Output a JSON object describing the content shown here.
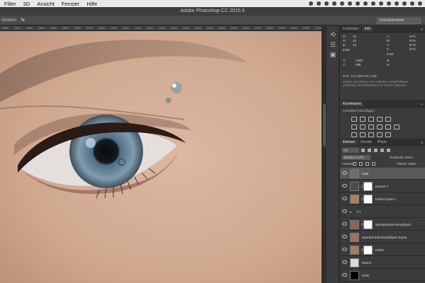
{
  "menubar": {
    "items": [
      "Filter",
      "3D",
      "Ansicht",
      "Fenster",
      "Hilfe"
    ]
  },
  "window": {
    "title": "Adobe Photoshop CC 2015.5"
  },
  "options_bar": {
    "left_label": "chützen",
    "workspace": "Grundelemente"
  },
  "ruler": {
    "ticks": [
      "1200",
      "1220",
      "1240",
      "1260",
      "1280",
      "1300",
      "1320",
      "1340",
      "1360",
      "1380",
      "1400",
      "1420",
      "1440",
      "1460",
      "1480",
      "1500",
      "1520",
      "1540",
      "1560",
      "1580",
      "1600",
      "1620",
      "1640",
      "1660",
      "1680",
      "1700",
      "1720"
    ]
  },
  "info_panel": {
    "tabs": [
      "Farbfelder",
      "Info"
    ],
    "active_tab": "Info",
    "rgb": {
      "r": "R:",
      "g": "G:",
      "b": "B:",
      "rv": "38",
      "gv": "42",
      "bv": "40"
    },
    "bit": "8-Bit",
    "cmyk": {
      "c": "C:",
      "m": "M:",
      "y": "Y:",
      "k": "K:",
      "cv": "67%",
      "mv": "67%",
      "yv": "67%",
      "kv": "67%"
    },
    "bit2": "8-Bit",
    "xy": {
      "x": "X:",
      "y": "Y:",
      "xv": "1405",
      "yv": "896"
    },
    "wh": {
      "w": "B:",
      "h": "H:"
    },
    "doc": "Dok: 73,8 MB/149,3 MB",
    "help": "Klicken und Ziehen zum Aufhellen, Umschalttaste, Wahltaste und Befehlstaste für weitere Optionen."
  },
  "korrekturen": {
    "title": "Korrekturen",
    "subtitle": "Korrektur hinzufügen"
  },
  "layers_panel": {
    "tabs": [
      "Ebenen",
      "Kanäle",
      "Pfade"
    ],
    "active_tab": "Ebenen",
    "filter": "Art",
    "blend_mode": "Weiches Licht",
    "opacity_label": "Deckkraft: 100%",
    "lock_label": "Fixieren:",
    "fill_label": "Fläche: 100%",
    "layers": [
      {
        "name": "D&B",
        "selected": true,
        "thumb": "#6e6e6e",
        "mask": false,
        "fold": false
      },
      {
        "name": "Kurven 1",
        "selected": false,
        "thumb": "#4a4a4a",
        "mask": true,
        "fold": false
      },
      {
        "name": "Farbe Kopie 2",
        "selected": false,
        "thumb": "#b07f5e",
        "mask": true,
        "fold": false
      },
      {
        "name": "FT",
        "selected": false,
        "thumb": "",
        "mask": false,
        "fold": true
      },
      {
        "name": "Sportportrait-Kampfsport",
        "selected": false,
        "thumb": "#8c6553",
        "mask": true,
        "fold": false
      },
      {
        "name": "Sportportrait-Kampfsport Kopie",
        "selected": false,
        "thumb": "#9a7360",
        "mask": false,
        "fold": false
      },
      {
        "name": "Farbe",
        "selected": false,
        "thumb": "#a77b5d",
        "mask": true,
        "fold": false
      },
      {
        "name": "Rauch",
        "selected": false,
        "thumb": "#d8d8d8",
        "mask": false,
        "fold": false
      },
      {
        "name": "HGR",
        "selected": false,
        "thumb": "#000000",
        "mask": false,
        "fold": false
      }
    ]
  },
  "colors": {
    "ui_dark": "#323232",
    "panel": "#3b3b3b",
    "skin": "#d2aa92",
    "iris": "#6f8ea3"
  }
}
